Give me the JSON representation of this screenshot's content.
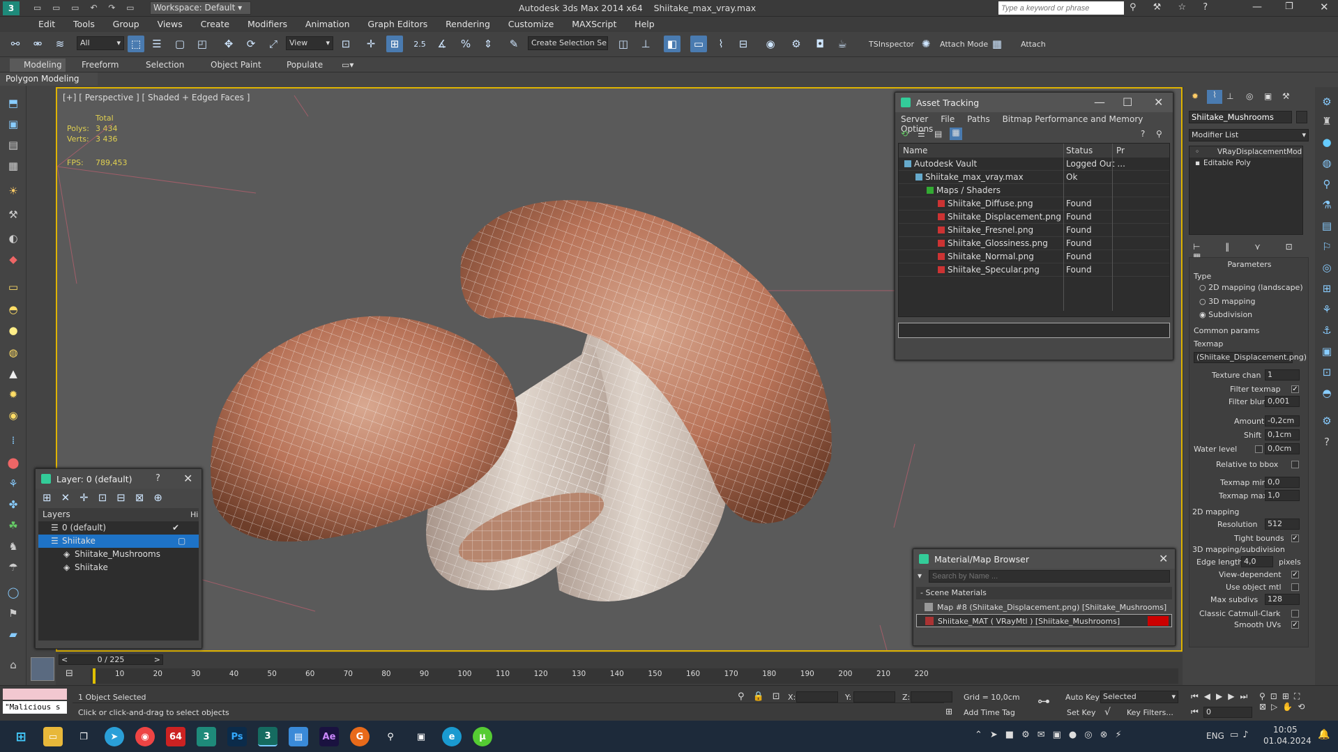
{
  "title": {
    "workspace": "Workspace: Default",
    "app": "Autodesk 3ds Max  2014 x64",
    "file": "Shiitake_max_vray.max",
    "search_placeholder": "Type a keyword or phrase"
  },
  "menu": [
    "Edit",
    "Tools",
    "Group",
    "Views",
    "Create",
    "Modifiers",
    "Animation",
    "Graph Editors",
    "Rendering",
    "Customize",
    "MAXScript",
    "Help"
  ],
  "toolbar": {
    "filter": "All",
    "view": "View",
    "snap_value": "2.5",
    "selection_set": "Create Selection Se",
    "tsinspector": "TSInspector",
    "attach_mode": "Attach Mode",
    "attach": "Attach"
  },
  "ribbon": {
    "tabs": [
      "Modeling",
      "Freeform",
      "Selection",
      "Object Paint",
      "Populate"
    ],
    "polygon_modeling": "Polygon Modeling"
  },
  "viewport": {
    "label": "[+] [ Perspective ] [ Shaded + Edged Faces ]",
    "stats_total": "Total",
    "polys_label": "Polys:",
    "polys_value": "3 434",
    "verts_label": "Verts:",
    "verts_value": "3 436",
    "fps_label": "FPS:",
    "fps_value": "789,453"
  },
  "asset_tracking": {
    "title": "Asset Tracking",
    "menu": [
      "Server",
      "File",
      "Paths",
      "Bitmap Performance and Memory",
      "Options"
    ],
    "col_name": "Name",
    "col_status": "Status",
    "col_extra": "Pr",
    "rows": [
      {
        "name": "Autodesk Vault",
        "status": "Logged Out ...",
        "indent": 0
      },
      {
        "name": "Shiitake_max_vray.max",
        "status": "Ok",
        "indent": 1
      },
      {
        "name": "Maps / Shaders",
        "status": "",
        "indent": 2
      },
      {
        "name": "Shiitake_Diffuse.png",
        "status": "Found",
        "indent": 3
      },
      {
        "name": "Shiitake_Displacement.png",
        "status": "Found",
        "indent": 3
      },
      {
        "name": "Shiitake_Fresnel.png",
        "status": "Found",
        "indent": 3
      },
      {
        "name": "Shiitake_Glossiness.png",
        "status": "Found",
        "indent": 3
      },
      {
        "name": "Shiitake_Normal.png",
        "status": "Found",
        "indent": 3
      },
      {
        "name": "Shiitake_Specular.png",
        "status": "Found",
        "indent": 3
      }
    ]
  },
  "layer": {
    "title": "Layer: 0 (default)",
    "help": "?",
    "col_layers": "Layers",
    "col_hide": "Hid",
    "rows": [
      {
        "name": "0 (default)"
      },
      {
        "name": "Shiitake"
      },
      {
        "name": "Shiitake_Mushrooms"
      },
      {
        "name": "Shiitake"
      }
    ]
  },
  "material_browser": {
    "title": "Material/Map Browser",
    "search_placeholder": "Search by Name ...",
    "section": "- Scene Materials",
    "items": [
      "Map #8 (Shiitake_Displacement.png) [Shiitake_Mushrooms]",
      "Shiitake_MAT  ( VRayMtl )  [Shiitake_Mushrooms]"
    ]
  },
  "command_panel": {
    "object_name": "Shiitake_Mushrooms",
    "modifier_list": "Modifier List",
    "stack": [
      "VRayDisplacementMod",
      "Editable Poly"
    ],
    "parameters": "Parameters",
    "type_label": "Type",
    "types": [
      "2D mapping (landscape)",
      "3D mapping",
      "Subdivision"
    ],
    "common_params": "Common params",
    "texmap": "Texmap",
    "texmap_value": "(Shiitake_Displacement.png)",
    "texture_chan_label": "Texture chan",
    "texture_chan": "1",
    "filter_texmap": "Filter texmap",
    "filter_blur_label": "Filter blur",
    "filter_blur": "0,001",
    "amount_label": "Amount",
    "amount": "-0,2cm",
    "shift_label": "Shift",
    "shift": "0,1cm",
    "water_level_label": "Water level",
    "water_level": "0,0cm",
    "relative_bbox": "Relative to bbox",
    "texmap_min_label": "Texmap min",
    "texmap_min": "0,0",
    "texmap_max_label": "Texmap max",
    "texmap_max": "1,0",
    "mapping2d": "2D mapping",
    "resolution_label": "Resolution",
    "resolution": "512",
    "tight_bounds": "Tight bounds",
    "mapping3d": "3D mapping/subdivision",
    "edge_length_label": "Edge length",
    "edge_length": "4,0",
    "pixels": "pixels",
    "view_dependent": "View-dependent",
    "use_object_mtl": "Use object mtl",
    "max_subdivs_label": "Max subdivs",
    "max_subdivs": "128",
    "classic_catmull": "Classic Catmull-Clark",
    "smooth_uvs": "Smooth UVs"
  },
  "timeline": {
    "frame": "0 / 225",
    "ticks": [
      "10",
      "20",
      "30",
      "40",
      "50",
      "60",
      "70",
      "80",
      "90",
      "100",
      "110",
      "120",
      "130",
      "140",
      "150",
      "160",
      "170",
      "180",
      "190",
      "200",
      "210",
      "220"
    ]
  },
  "status": {
    "script": "\"Malicious s",
    "selected": "1 Object Selected",
    "prompt": "Click or click-and-drag to select objects",
    "x_label": "X:",
    "y_label": "Y:",
    "z_label": "Z:",
    "grid": "Grid = 10,0cm",
    "auto_key": "Auto Key",
    "selected_mode": "Selected",
    "set_key": "Set Key",
    "key_filters": "Key Filters...",
    "add_time_tag": "Add Time Tag",
    "frame_value": "0"
  },
  "taskbar": {
    "lang": "ENG",
    "time": "10:05",
    "date": "01.04.2024"
  }
}
